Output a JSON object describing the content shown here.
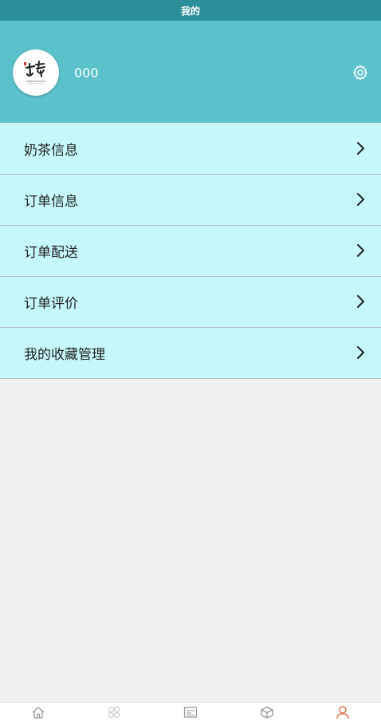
{
  "status_bar": {
    "title": "我的"
  },
  "profile": {
    "username": "000",
    "avatar_icon": "brand-logo",
    "settings_icon": "gear-icon"
  },
  "menu": {
    "items": [
      {
        "label": "奶茶信息",
        "icon": "chevron-right-icon"
      },
      {
        "label": "订单信息",
        "icon": "chevron-right-icon"
      },
      {
        "label": "订单配送",
        "icon": "chevron-right-icon"
      },
      {
        "label": "订单评价",
        "icon": "chevron-right-icon"
      },
      {
        "label": "我的收藏管理",
        "icon": "chevron-right-icon"
      }
    ]
  },
  "tab_bar": {
    "tabs": [
      {
        "icon": "home-icon",
        "active": false
      },
      {
        "icon": "grid-icon",
        "active": false
      },
      {
        "icon": "news-icon",
        "active": false
      },
      {
        "icon": "box-icon",
        "active": false
      },
      {
        "icon": "user-icon",
        "active": true
      }
    ]
  },
  "colors": {
    "status_bar": "#2a8f98",
    "header": "#5bc1cb",
    "menu_bg": "#c6f8fb",
    "page_bg": "#f0f0ee",
    "tab_inactive": "#9a9a9a",
    "tab_active": "#e0704a"
  }
}
